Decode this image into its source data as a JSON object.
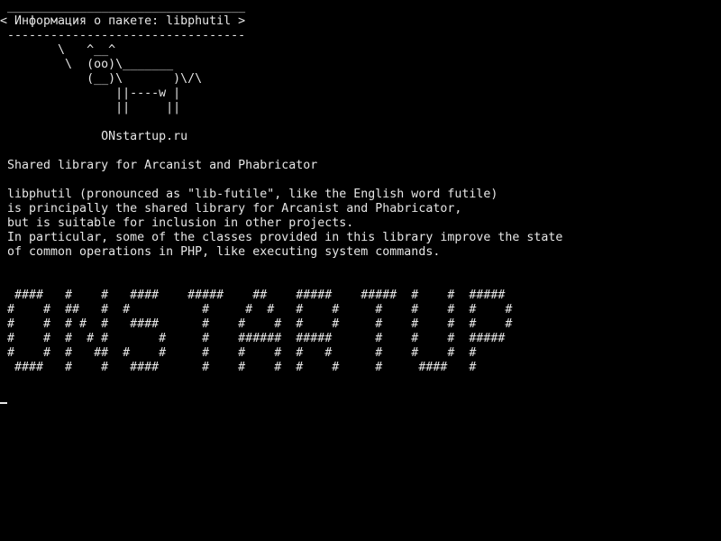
{
  "terminal": {
    "bubble": {
      "top_border": " _________________________________",
      "text": "< Информация о пакете: libphutil >",
      "bottom_border": " ---------------------------------"
    },
    "cow": [
      "        \\   ^__^",
      "         \\  (oo)\\_______",
      "            (__)\\       )\\/\\",
      "                ||----w |",
      "                ||     ||"
    ],
    "site": "              ONstartup.ru",
    "summary": " Shared library for Arcanist and Phabricator",
    "description": [
      " libphutil (pronounced as \"lib-futile\", like the English word futile)",
      " is principally the shared library for Arcanist and Phabricator,",
      " but is suitable for inclusion in other projects.",
      " In particular, some of the classes provided in this library improve the state",
      " of common operations in PHP, like executing system commands."
    ],
    "banner": [
      "  ####   #    #   ####    #####    ##    #####    #####  #    #  #####",
      " #    #  ##   #  #          #     #  #   #    #     #    #    #  #    #",
      " #    #  # #  #   ####      #    #    #  #    #     #    #    #  #    #",
      " #    #  #  # #       #     #    ######  #####      #    #    #  #####",
      " #    #  #   ##  #    #     #    #    #  #   #      #    #    #  #",
      "  ####   #    #   ####      #    #    #  #    #     #     ####   #"
    ],
    "cursor_char": "_"
  }
}
